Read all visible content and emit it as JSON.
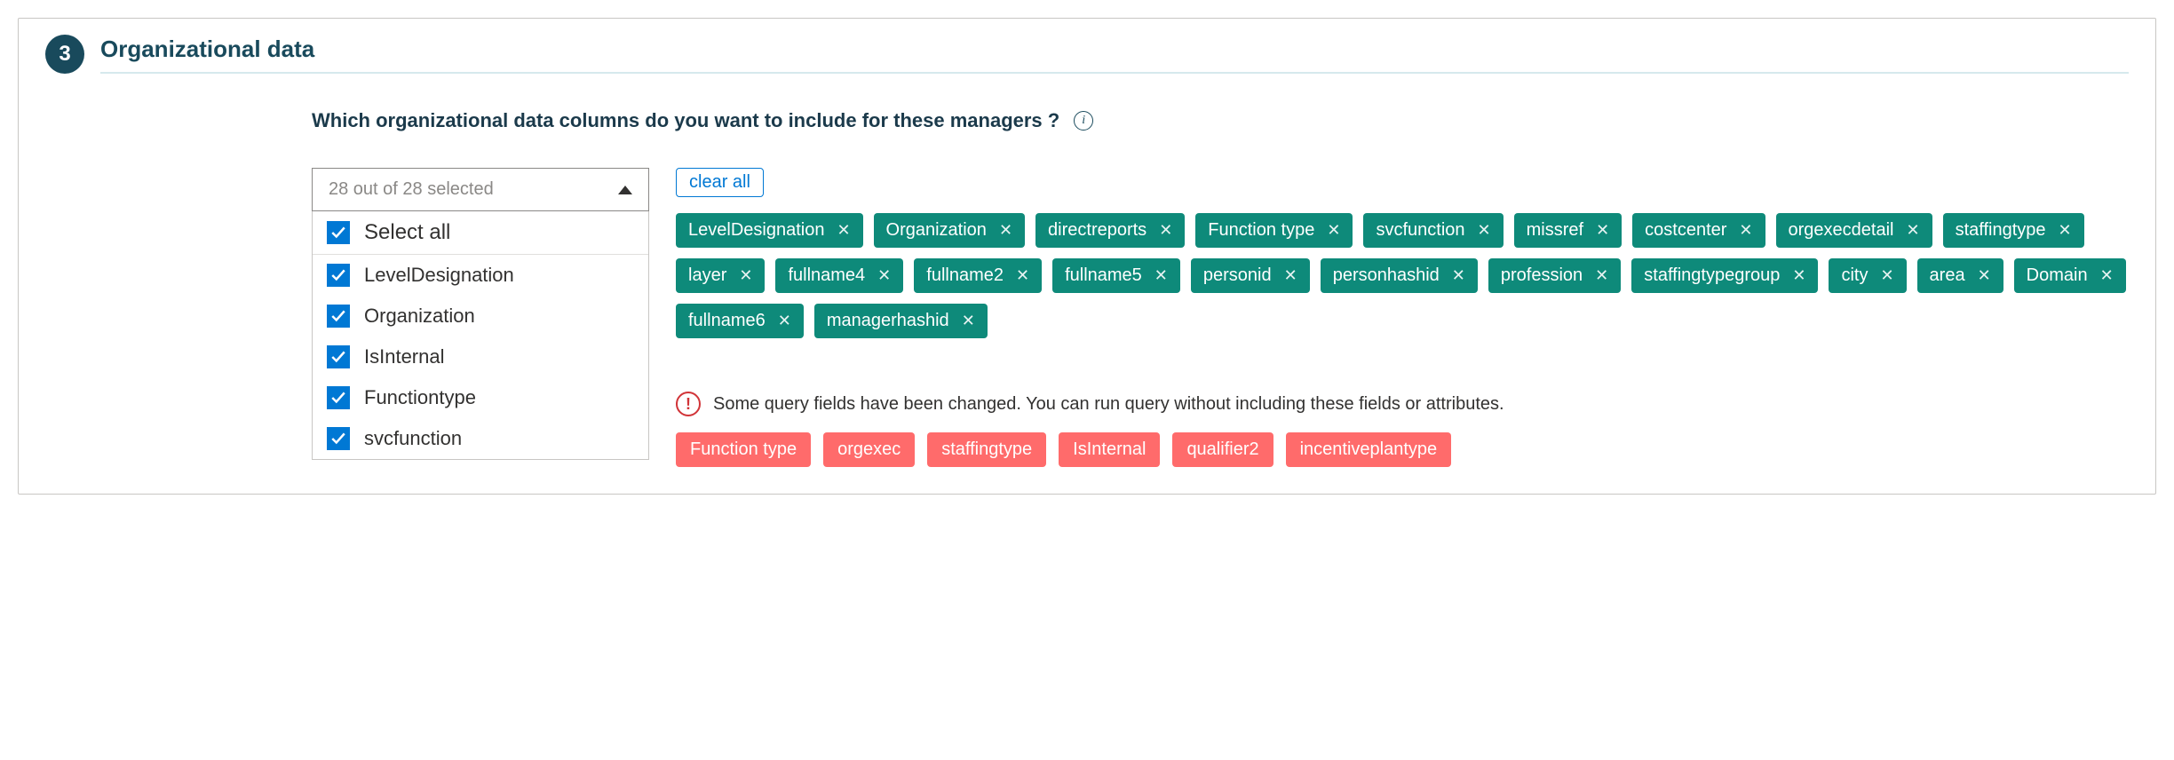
{
  "step": {
    "number": "3",
    "title": "Organizational data"
  },
  "question": "Which organizational data columns do you want to include for these managers ?",
  "dropdown": {
    "summary": "28 out of 28 selected",
    "select_all_label": "Select all",
    "items": [
      {
        "label": "LevelDesignation"
      },
      {
        "label": "Organization"
      },
      {
        "label": "IsInternal"
      },
      {
        "label": "Functiontype"
      },
      {
        "label": "svcfunction"
      }
    ]
  },
  "clear_all_label": "clear all",
  "selected_chips": [
    "LevelDesignation",
    "Organization",
    "directreports",
    "Function type",
    "svcfunction",
    "missref",
    "costcenter",
    "orgexecdetail",
    "staffingtype",
    "layer",
    "fullname4",
    "fullname2",
    "fullname5",
    "personid",
    "personhashid",
    "profession",
    "staffingtypegroup",
    "city",
    "area",
    "Domain",
    "fullname6",
    "managerhashid"
  ],
  "warning": {
    "text": "Some query fields have been changed. You can run query without including these fields or attributes."
  },
  "changed_fields": [
    "Function type",
    "orgexec",
    "staffingtype",
    "IsInternal",
    "qualifier2",
    "incentiveplantype"
  ]
}
